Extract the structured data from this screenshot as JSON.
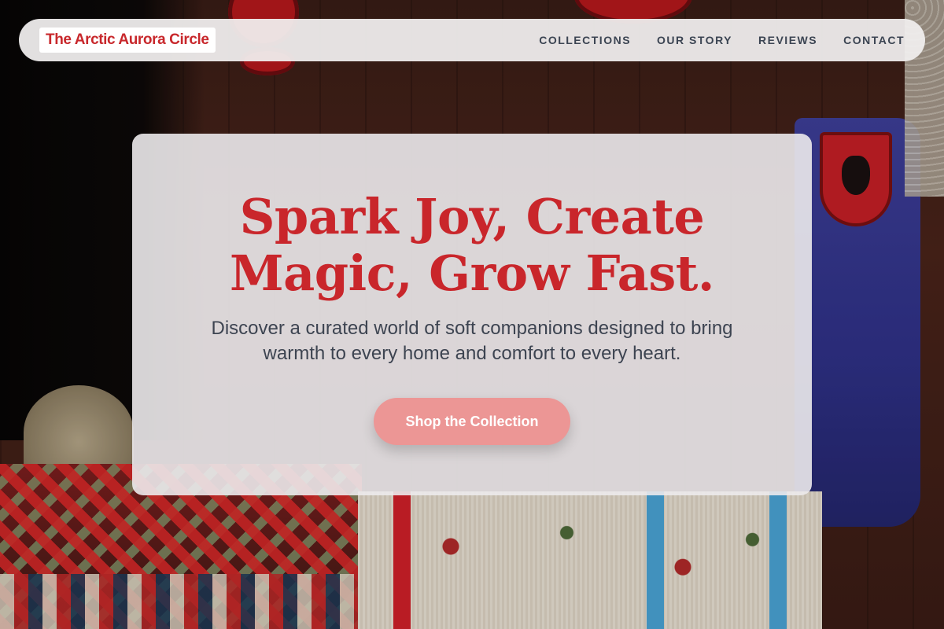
{
  "brand": {
    "name": "The Arctic Aurora Circle",
    "color": "#c8282c"
  },
  "nav": {
    "items": [
      {
        "label": "COLLECTIONS"
      },
      {
        "label": "OUR STORY"
      },
      {
        "label": "REVIEWS"
      },
      {
        "label": "CONTACT"
      }
    ]
  },
  "hero": {
    "headline_line1": "Spark Joy, Create",
    "headline_line2": "Magic, Grow Fast.",
    "subtitle": "Discover a curated world of soft companions designed to bring warmth to every home and comfort to every heart.",
    "cta_label": "Shop the Collection"
  },
  "colors": {
    "accent": "#c9262b",
    "cta_background": "#ec9695",
    "nav_text": "#3b4452",
    "body_text": "#3d4451"
  }
}
